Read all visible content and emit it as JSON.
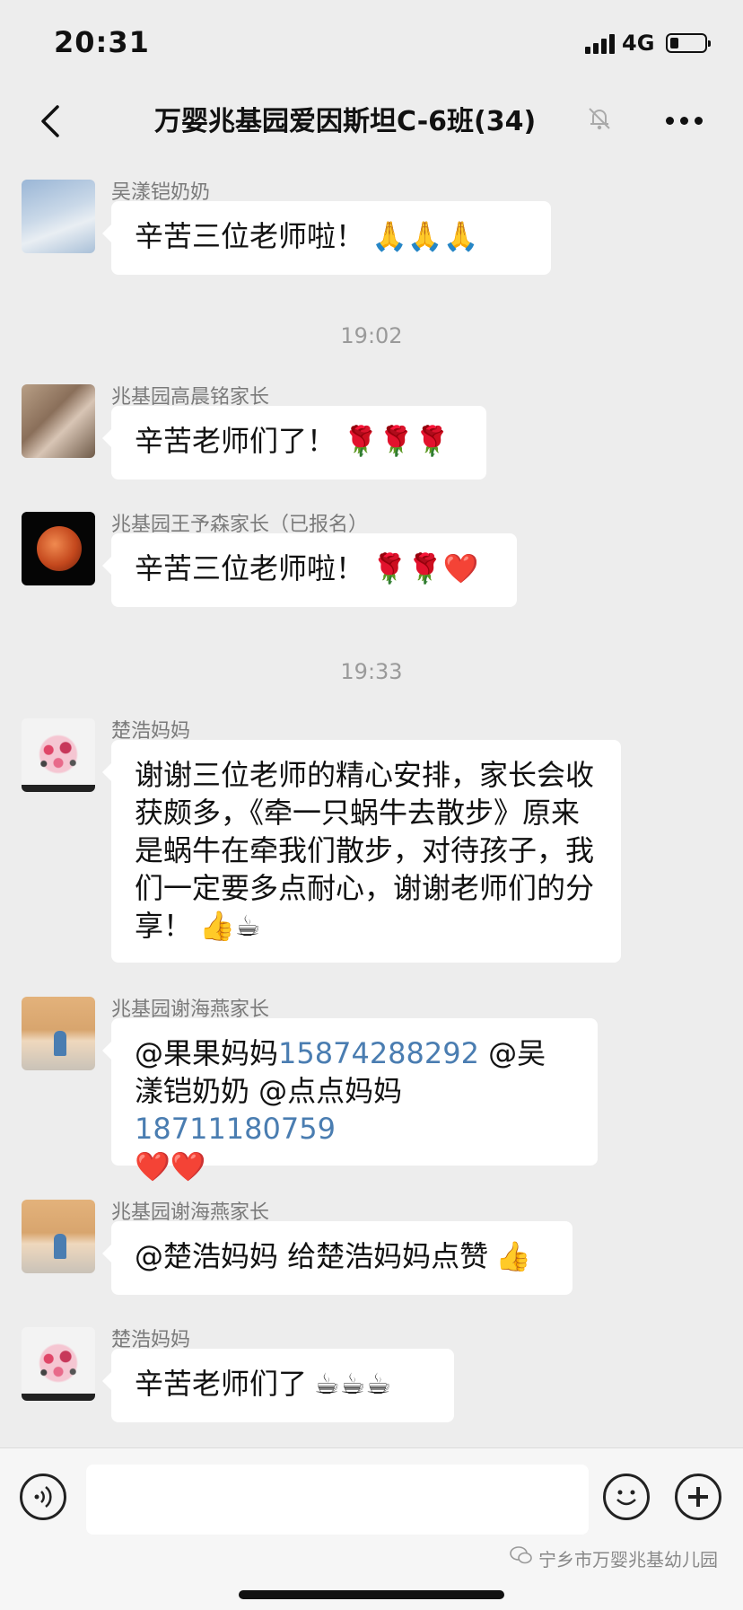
{
  "status_bar": {
    "time": "20:31",
    "network": "4G",
    "battery_level": 0.25
  },
  "nav": {
    "title": "万婴兆基园爱因斯坦C-6班(34)",
    "muted": true
  },
  "messages": [
    {
      "type": "message",
      "sender": "吴漾铠奶奶",
      "avatar": "sky-photo",
      "text": "辛苦三位老师啦！",
      "emoji": "🙏🙏🙏"
    },
    {
      "type": "time",
      "text": "19:02"
    },
    {
      "type": "message",
      "sender": "兆基园高晨铭家长",
      "avatar": "kids-photo",
      "text": "辛苦老师们了！",
      "emoji": "🌹🌹🌹"
    },
    {
      "type": "message",
      "sender": "兆基园王予森家长（已报名）",
      "avatar": "red-moon",
      "text": "辛苦三位老师啦！",
      "emoji": "🌹🌹❤️"
    },
    {
      "type": "time",
      "text": "19:33"
    },
    {
      "type": "message",
      "sender": "楚浩妈妈",
      "avatar": "flower-drawing",
      "text": "谢谢三位老师的精心安排，家长会收获颇多，《牵一只蜗牛去散步》原来是蜗牛在牵我们散步，对待孩子，我们一定要多点耐心，谢谢老师们的分享！",
      "emoji": "👍☕"
    },
    {
      "type": "message",
      "sender": "兆基园谢海燕家长",
      "avatar": "room-photo",
      "parts": [
        "@果果妈妈",
        "15874288292",
        "@吴漾铠奶奶 @点点妈妈",
        "18711180759"
      ],
      "emoji": "❤️❤️"
    },
    {
      "type": "message",
      "sender": "兆基园谢海燕家长",
      "avatar": "room-photo",
      "text": "@楚浩妈妈 给楚浩妈妈点赞",
      "emoji": "👍"
    },
    {
      "type": "message",
      "sender": "楚浩妈妈",
      "avatar": "flower-drawing",
      "text": "辛苦老师们了",
      "emoji": "☕☕☕"
    }
  ],
  "input": {
    "placeholder": ""
  },
  "watermark": "宁乡市万婴兆基幼儿园"
}
